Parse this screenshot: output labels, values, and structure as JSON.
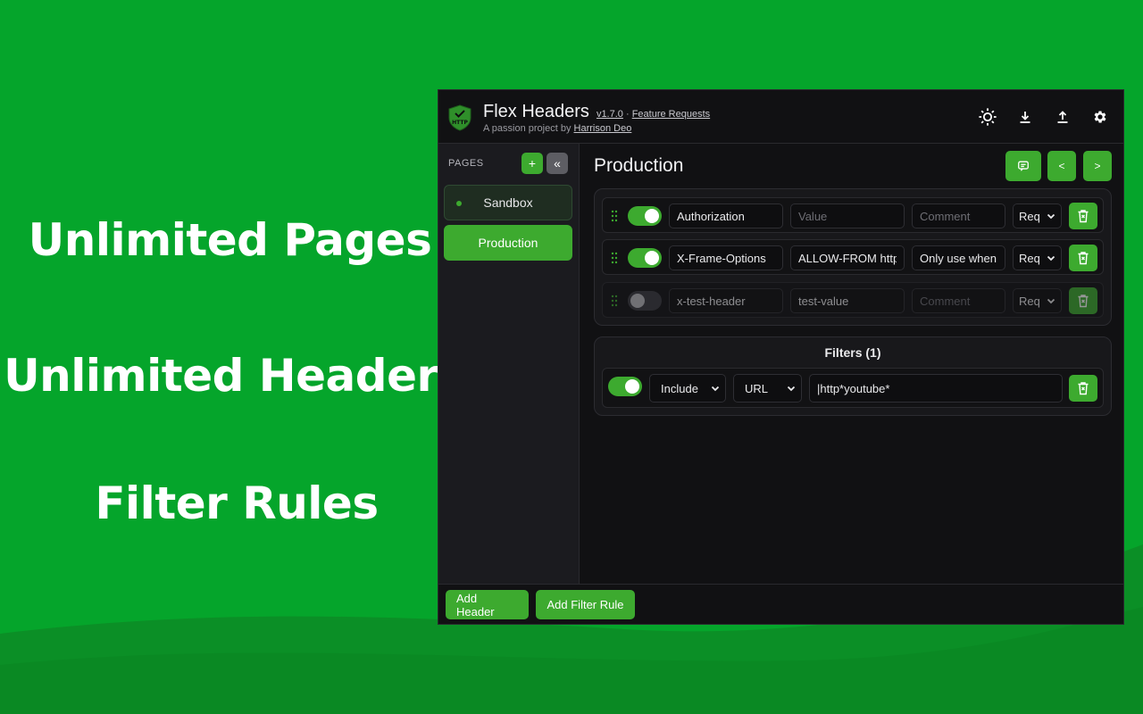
{
  "promo": {
    "line1": "Unlimited Pages",
    "line2": "Unlimited Headers",
    "line3": "Filter Rules"
  },
  "header": {
    "title": "Flex Headers",
    "version": "v1.7.0",
    "separator": "·",
    "feature_requests": "Feature Requests",
    "subtitle_prefix": "A passion project by",
    "author": "Harrison Deo",
    "icons": [
      "sun-icon",
      "download-icon",
      "upload-icon",
      "gear-icon"
    ]
  },
  "sidebar": {
    "label": "PAGES",
    "add_label": "+",
    "collapse_label": "«",
    "items": [
      {
        "label": "Sandbox",
        "active": false
      },
      {
        "label": "Production",
        "active": true
      }
    ]
  },
  "main": {
    "page_title": "Production",
    "prev_label": "<",
    "next_label": ">",
    "headers": [
      {
        "enabled": true,
        "name": "Authorization",
        "value": "",
        "value_placeholder": "Value",
        "comment": "",
        "comment_placeholder": "Comment",
        "type": "Req"
      },
      {
        "enabled": true,
        "name": "X-Frame-Options",
        "value": "ALLOW-FROM https",
        "value_placeholder": "Value",
        "comment": "Only use when",
        "comment_placeholder": "Comment",
        "type": "Req"
      },
      {
        "enabled": false,
        "name": "x-test-header",
        "value": "test-value",
        "value_placeholder": "Value",
        "comment": "",
        "comment_placeholder": "Comment",
        "type": "Req"
      }
    ],
    "filters_title": "Filters (1)",
    "filters": [
      {
        "enabled": true,
        "mode": "Include",
        "target": "URL",
        "pattern": "|http*youtube*"
      }
    ]
  },
  "footer": {
    "add_header": "Add Header",
    "add_filter": "Add Filter Rule"
  },
  "colors": {
    "accent": "#3daa2f",
    "background": "#05a52b",
    "app_bg": "#111113"
  }
}
